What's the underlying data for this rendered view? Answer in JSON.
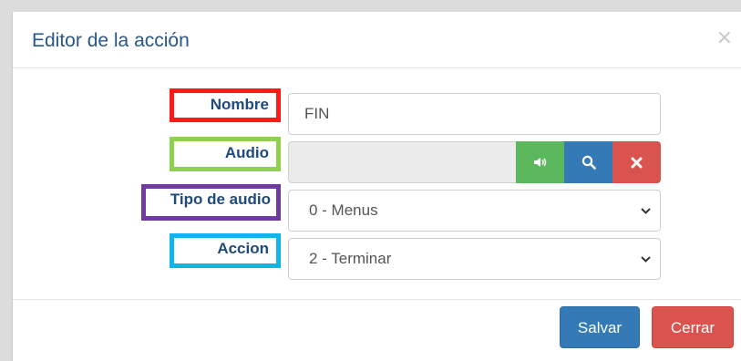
{
  "modal": {
    "title": "Editor de la acción",
    "close_glyph": "×"
  },
  "form": {
    "nombre": {
      "label": "Nombre",
      "value": "FIN"
    },
    "audio": {
      "label": "Audio",
      "value": "",
      "buttons": [
        "volume-icon",
        "search-icon",
        "remove-icon"
      ]
    },
    "tipo_audio": {
      "label": "Tipo de audio",
      "selected": "0 - Menus"
    },
    "accion": {
      "label": "Accion",
      "selected": "2 - Terminar"
    }
  },
  "footer": {
    "save_label": "Salvar",
    "close_label": "Cerrar"
  },
  "colors": {
    "primary": "#337ab7",
    "success": "#5cb85c",
    "danger": "#d9534f",
    "label_text": "#1f4a7e",
    "nombre_highlight": "#ff1a1a",
    "audio_highlight": "#8fd14f",
    "tipo_highlight": "#6f3aa1",
    "accion_highlight": "#12b5ea"
  }
}
